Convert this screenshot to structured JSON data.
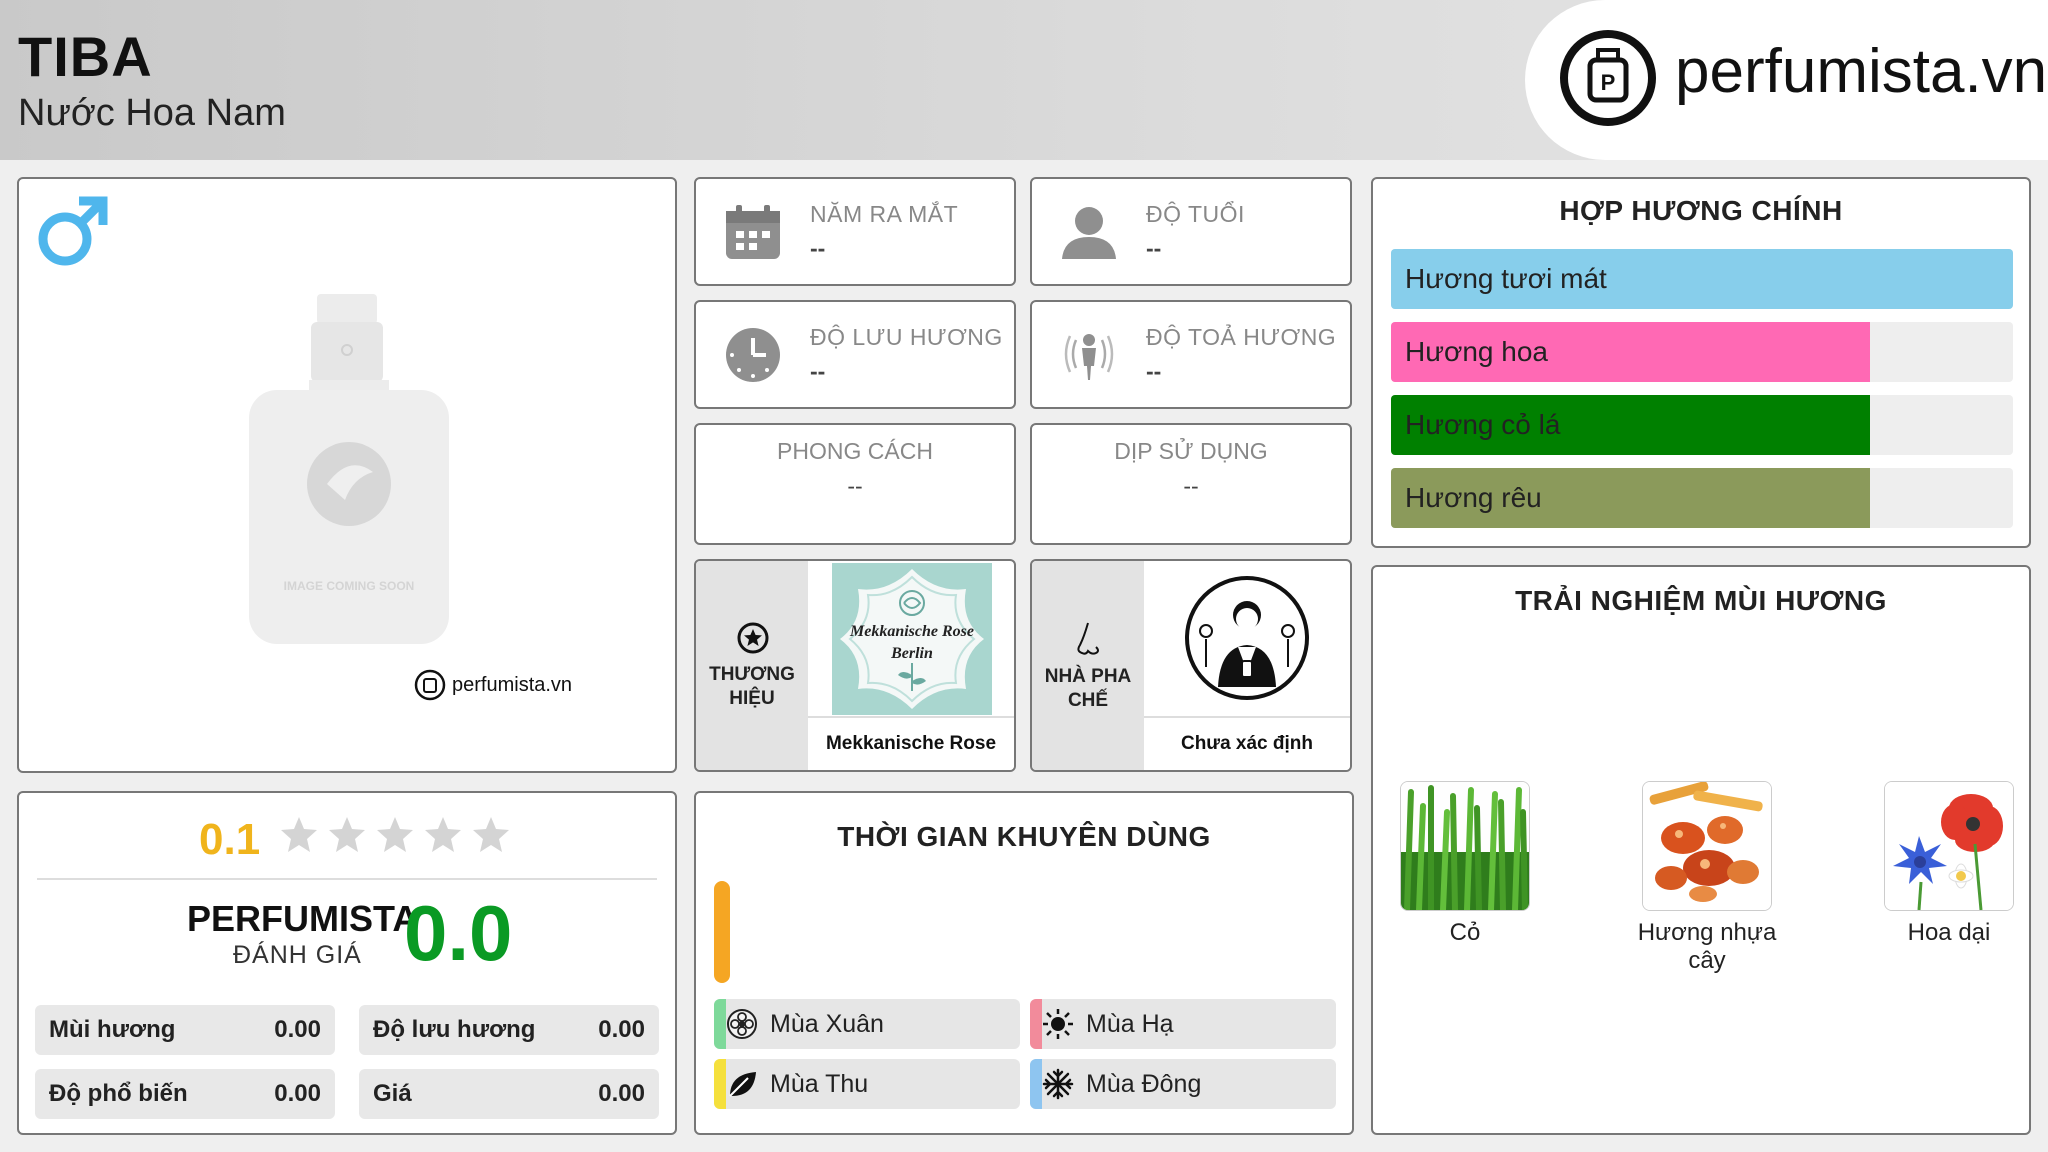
{
  "header": {
    "title": "TIBA",
    "subtitle": "Nước Hoa Nam",
    "logo_text": "perfumista.vn"
  },
  "product": {
    "gender_icon": "male-symbol-icon",
    "image_placeholder_text": "IMAGE COMING SOON",
    "watermark": "perfumista.vn"
  },
  "info": {
    "launch_year": {
      "label": "NĂM RA MẮT",
      "value": "--"
    },
    "age": {
      "label": "ĐỘ TUỔI",
      "value": "--"
    },
    "longevity": {
      "label": "ĐỘ LƯU HƯƠNG",
      "value": "--"
    },
    "sillage": {
      "label": "ĐỘ TOẢ HƯƠNG",
      "value": "--"
    },
    "style": {
      "label": "PHONG CÁCH",
      "value": "--"
    },
    "occasion": {
      "label": "DỊP SỬ DỤNG",
      "value": "--"
    }
  },
  "brand": {
    "label_line1": "THƯƠNG",
    "label_line2": "HIỆU",
    "logo_text_1": "Mekkanische Rose",
    "logo_text_2": "Berlin",
    "name": "Mekkanische Rose"
  },
  "perfumer": {
    "label_line1": "NHÀ PHA",
    "label_line2": "CHẾ",
    "name": "Chưa xác định"
  },
  "accords": {
    "title": "HỢP HƯƠNG CHÍNH",
    "items": [
      {
        "label": "Hương tươi mát",
        "percent": 100,
        "color": "#87ceeb"
      },
      {
        "label": "Hương hoa",
        "percent": 77,
        "color": "#ff69b4"
      },
      {
        "label": "Hương cỏ lá",
        "percent": 77,
        "color": "#008000"
      },
      {
        "label": "Hương rêu",
        "percent": 77,
        "color": "#8b9a5b"
      }
    ]
  },
  "notes": {
    "title": "TRẢI NGHIỆM MÙI HƯƠNG",
    "items": [
      {
        "label": "Cỏ"
      },
      {
        "label_line1": "Hương nhựa",
        "label_line2": "cây"
      },
      {
        "label": "Hoa dại"
      }
    ]
  },
  "rating": {
    "user_score": "0.1",
    "stars_filled": 0,
    "stars_total": 5,
    "perfumista_label": "PERFUMISTA",
    "perfumista_sub": "ĐÁNH GIÁ",
    "perfumista_score": "0.0",
    "metrics": [
      {
        "label": "Mùi hương",
        "value": "0.00"
      },
      {
        "label": "Độ lưu hương",
        "value": "0.00"
      },
      {
        "label": "Độ phổ biến",
        "value": "0.00"
      },
      {
        "label": "Giá",
        "value": "0.00"
      }
    ]
  },
  "recommended_time": {
    "title": "THỜI GIAN KHUYÊN DÙNG",
    "day_night_color": "#f5a623",
    "seasons": [
      {
        "label": "Mùa Xuân",
        "color": "#7ed99a"
      },
      {
        "label": "Mùa Hạ",
        "color": "#f28b9b"
      },
      {
        "label": "Mùa Thu",
        "color": "#f5e03c"
      },
      {
        "label": "Mùa Đông",
        "color": "#8ec5f0"
      }
    ]
  }
}
